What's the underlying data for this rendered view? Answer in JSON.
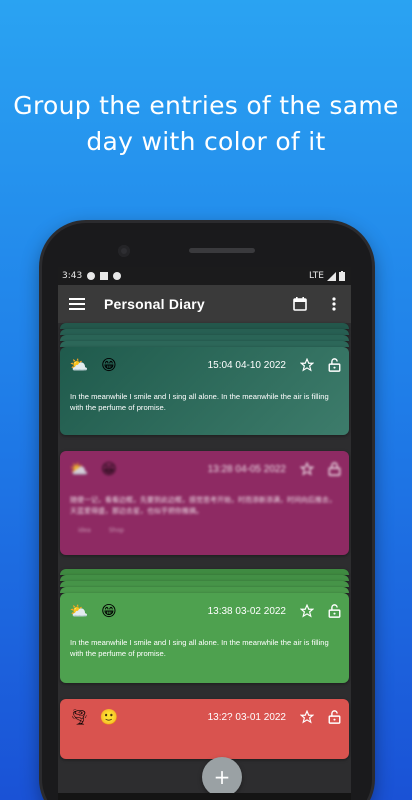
{
  "headline": {
    "line1": "Group the entries of the same",
    "line2": "day with color of it"
  },
  "status_bar": {
    "time": "3:43",
    "network": "LTE"
  },
  "app_bar": {
    "title": "Personal Diary",
    "menu_icon": "hamburger-menu-icon",
    "calendar_icon": "calendar-icon",
    "overflow_icon": "more-vert-icon"
  },
  "entries": [
    {
      "weather": "partly-cloudy",
      "mood": "grinning",
      "date": "15:04 04-10 2022",
      "text": "In the meanwhile I smile and I sing all alone. In the meanwhile the air is filling with the perfume of promise.",
      "color": "#2f6b5c"
    },
    {
      "weather": "partly-cloudy",
      "mood": "grinning",
      "date": "13:28 04-05 2022",
      "text": "随便一记，看看边框，先要到此边框，感觉思考开始，时而添新添满，时间向后推去，天蓝爱得盛，那边去星，也似乎把你推搞。",
      "tags": [
        "idea",
        "Shop"
      ],
      "color": "#8e2a63"
    },
    {
      "weather": "partly-cloudy",
      "mood": "grinning",
      "date": "13:38 03-02 2022",
      "text": "In the meanwhile I smile and I sing all alone. In the meanwhile the air is filling with the perfume of promise.",
      "color": "#4ea14f"
    },
    {
      "weather": "tornado",
      "mood": "smiling",
      "date": "13:2? 03-01 2022",
      "color": "#d9534f"
    }
  ],
  "fab": {
    "label": "+"
  },
  "colors": {
    "accent_teal": "#2f6b5c",
    "accent_magenta": "#8e2a63",
    "accent_green": "#4ea14f",
    "accent_red": "#d9534f"
  }
}
